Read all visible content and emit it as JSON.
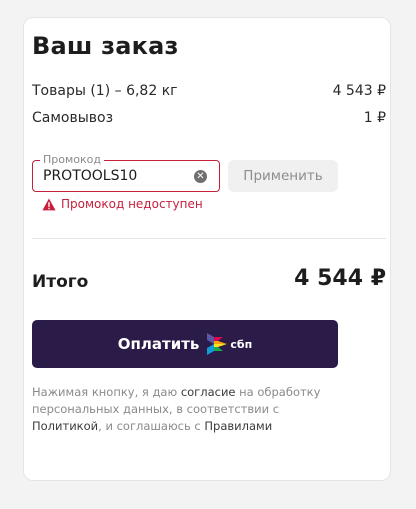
{
  "order": {
    "title": "Ваш заказ",
    "goods_label": "Товары (1) – 6,82 кг",
    "goods_price": "4 543 ₽",
    "pickup_label": "Самовывоз",
    "pickup_price": "1 ₽"
  },
  "promo": {
    "legend": "Промокод",
    "value": "PROTOOLS10",
    "apply_label": "Применить",
    "error_text": "Промокод недоступен"
  },
  "total": {
    "label": "Итого",
    "value": "4 544 ₽"
  },
  "pay": {
    "label": "Оплатить",
    "sbp_text": "сбп"
  },
  "consent": {
    "part1": "Нажимая кнопку, я даю ",
    "link1": "согласие",
    "part2": " на обработку персональных данных, в соответствии с ",
    "link2": "Политикой",
    "part3": ", и соглашаюсь с ",
    "link3": "Правилами"
  },
  "colors": {
    "accent": "#2a1b48",
    "error": "#c6203c"
  }
}
